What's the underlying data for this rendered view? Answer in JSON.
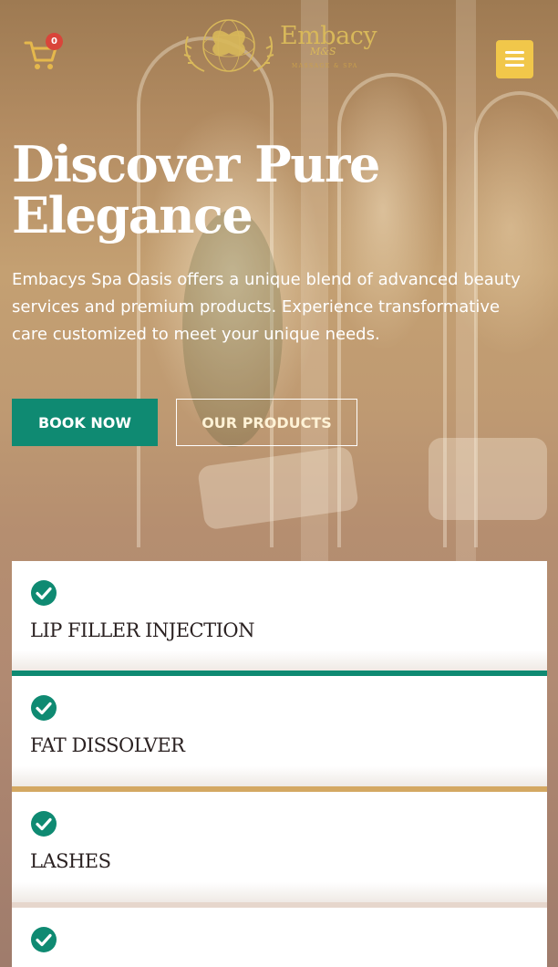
{
  "header": {
    "cart_count": "0",
    "logo_name": "Embacy",
    "logo_script": "M&S",
    "logo_tagline": "MASSAGE & SPA",
    "cart_icon": "shopping-cart-icon",
    "menu_icon": "hamburger-menu-icon"
  },
  "hero": {
    "title": "Discover Pure Elegance",
    "description": "Embacys Spa Oasis offers a unique blend of advanced beauty services and premium products. Experience transformative care customized to meet your unique needs.",
    "book_label": "BOOK NOW",
    "products_label": "OUR PRODUCTS"
  },
  "services": [
    {
      "label": "LIP FILLER INJECTION",
      "icon": "check-circle-icon"
    },
    {
      "label": "FAT DISSOLVER",
      "icon": "check-circle-icon"
    },
    {
      "label": "LASHES",
      "icon": "check-circle-icon"
    },
    {
      "label": "",
      "icon": "check-circle-icon"
    }
  ],
  "colors": {
    "accent_green": "#0f8a72",
    "accent_gold": "#d4a862",
    "menu_yellow": "#f1c74a",
    "badge_red": "#d9453a"
  }
}
